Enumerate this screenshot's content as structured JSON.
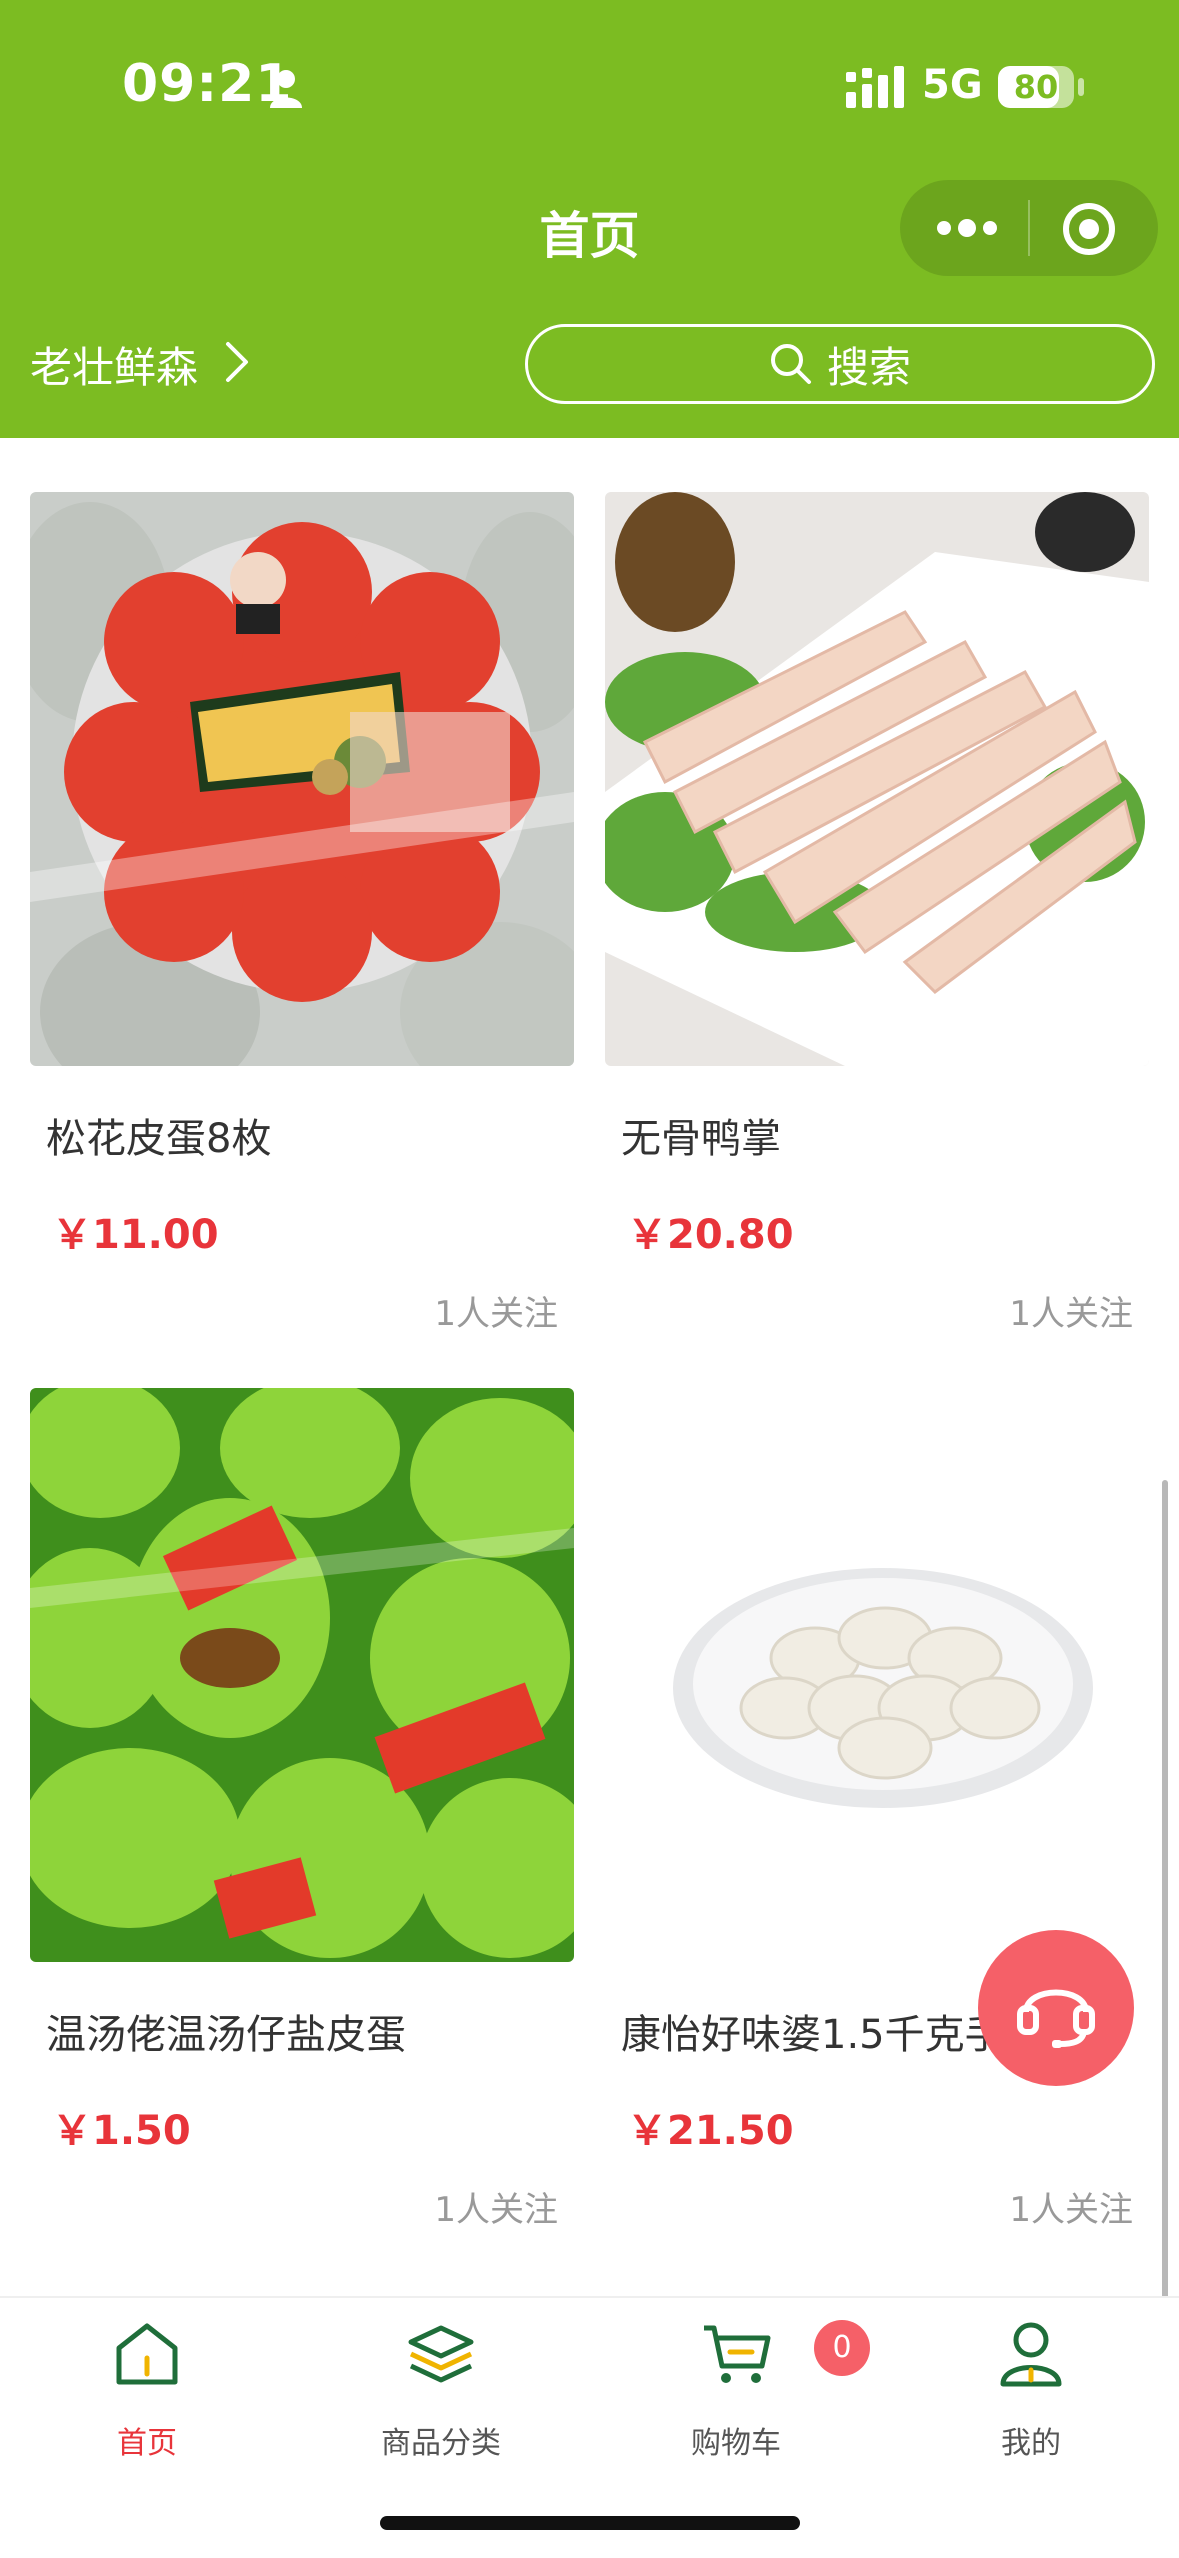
{
  "status_bar": {
    "time": "09:21",
    "network": "5G",
    "battery": "80",
    "battery_level": 0.8
  },
  "header": {
    "title": "首页",
    "store_name": "老壮鲜森",
    "search_placeholder": "搜索"
  },
  "colors": {
    "brand_green": "#7cbc22",
    "price_red": "#e8343a",
    "badge_red": "#f56068",
    "tab_icon_green": "#1f6e3a"
  },
  "products": [
    {
      "name": "松花皮蛋8枚",
      "price": "￥11.00",
      "follow": "1人关注"
    },
    {
      "name": "无骨鸭掌",
      "price": "￥20.80",
      "follow": "1人关注"
    },
    {
      "name": "温汤佬温汤仔盐皮蛋",
      "price": "￥1.50",
      "follow": "1人关注"
    },
    {
      "name": "康怡好味婆1.5千克手",
      "price": "￥21.50",
      "follow": "1人关注"
    }
  ],
  "tabbar": {
    "tabs": [
      {
        "label": "首页",
        "icon": "home-icon"
      },
      {
        "label": "商品分类",
        "icon": "layers-icon"
      },
      {
        "label": "购物车",
        "icon": "cart-icon"
      },
      {
        "label": "我的",
        "icon": "user-icon"
      }
    ],
    "cart_count": "0"
  },
  "icons": {
    "customer_service": "headset-icon",
    "search": "search-icon",
    "more": "more-icon",
    "close": "target-icon"
  }
}
